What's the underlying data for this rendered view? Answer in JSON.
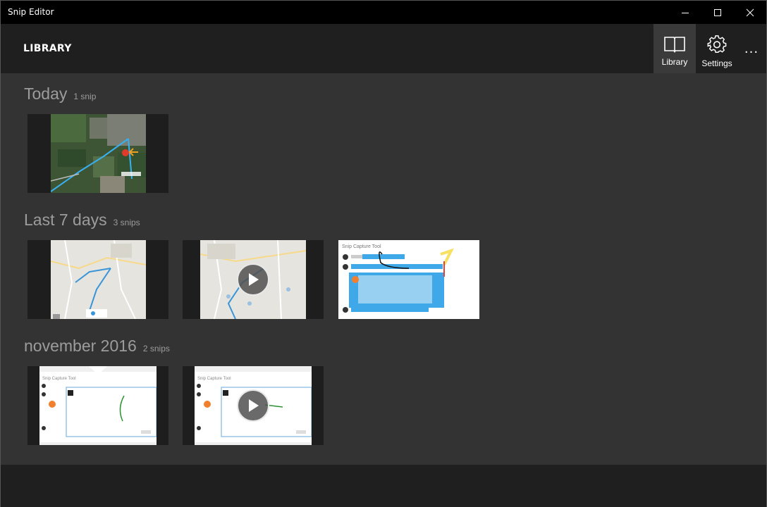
{
  "window": {
    "title": "Snip Editor",
    "controls": [
      "minimize",
      "maximize",
      "close"
    ]
  },
  "header": {
    "title": "LIBRARY",
    "buttons": [
      {
        "label": "Library",
        "icon": "book-icon",
        "active": true
      },
      {
        "label": "Settings",
        "icon": "gear-icon",
        "active": false
      }
    ],
    "more": "..."
  },
  "groups": [
    {
      "title": "Today",
      "count": "1 snip",
      "snips": [
        {
          "kind": "map-satellite",
          "video": false
        }
      ]
    },
    {
      "title": "Last 7 days",
      "count": "3 snips",
      "snips": [
        {
          "kind": "map-street",
          "video": false
        },
        {
          "kind": "map-street",
          "video": true
        },
        {
          "kind": "document-annotated",
          "video": false
        }
      ]
    },
    {
      "title": "november 2016",
      "count": "2 snips",
      "snips": [
        {
          "kind": "document-dialog",
          "video": false
        },
        {
          "kind": "document-dialog",
          "video": true
        }
      ]
    }
  ],
  "snip_preview_text": {
    "doc_title": "Snip Capture Tool"
  },
  "colors": {
    "titlebar": "#000000",
    "commandbar": "#1f1f1f",
    "content": "#333333",
    "group_text": "#9c9c9c",
    "accent_blue": "#3ea8e8"
  }
}
